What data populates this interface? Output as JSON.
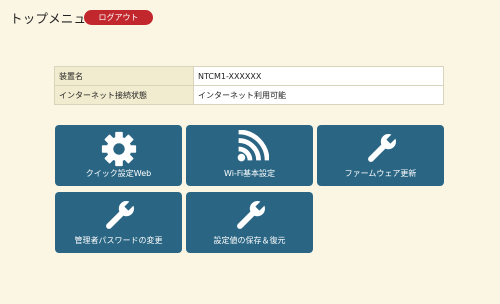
{
  "header": {
    "title": "トップメニュー",
    "logout_label": "ログアウト"
  },
  "info": [
    {
      "label": "装置名",
      "value": "NTCM1-XXXXXX"
    },
    {
      "label": "インターネット接続状態",
      "value": "インターネット利用可能"
    }
  ],
  "tiles": [
    {
      "label": "クイック設定Web",
      "icon": "gear-icon"
    },
    {
      "label": "Wi-Fi基本設定",
      "icon": "wifi-icon"
    },
    {
      "label": "ファームウェア更新",
      "icon": "wrench-icon"
    },
    {
      "label": "管理者パスワードの変更",
      "icon": "wrench-icon"
    },
    {
      "label": "設定値の保存＆復元",
      "icon": "wrench-icon"
    }
  ],
  "colors": {
    "background": "#fbf6e3",
    "tile": "#2a6684",
    "logout": "#c1272d"
  }
}
